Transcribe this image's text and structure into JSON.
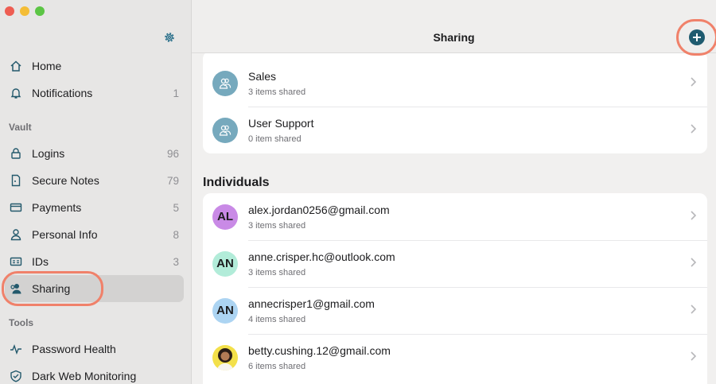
{
  "sidebar": {
    "items": [
      {
        "label": "Home",
        "icon": "home-icon",
        "count": ""
      },
      {
        "label": "Notifications",
        "icon": "bell-icon",
        "count": "1"
      }
    ],
    "vault_label": "Vault",
    "vault_items": [
      {
        "label": "Logins",
        "icon": "lock-icon",
        "count": "96"
      },
      {
        "label": "Secure Notes",
        "icon": "note-icon",
        "count": "79"
      },
      {
        "label": "Payments",
        "icon": "card-icon",
        "count": "5"
      },
      {
        "label": "Personal Info",
        "icon": "person-icon",
        "count": "8"
      },
      {
        "label": "IDs",
        "icon": "id-card-icon",
        "count": "3"
      },
      {
        "label": "Sharing",
        "icon": "sharing-icon",
        "count": ""
      }
    ],
    "tools_label": "Tools",
    "tool_items": [
      {
        "label": "Password Health",
        "icon": "pulse-icon"
      },
      {
        "label": "Dark Web Monitoring",
        "icon": "shield-icon"
      }
    ],
    "selected": "Sharing"
  },
  "header": {
    "title": "Sharing"
  },
  "groups": [
    {
      "name": "Sales",
      "sub": "3 items shared",
      "icon": "group-icon"
    },
    {
      "name": "User Support",
      "sub": "0 item shared",
      "icon": "group-icon"
    }
  ],
  "individuals_label": "Individuals",
  "individuals": [
    {
      "email": "alex.jordan0256@gmail.com",
      "sub": "3 items shared",
      "initials": "AL",
      "color": "#c98ae6"
    },
    {
      "email": "anne.crisper.hc@outlook.com",
      "sub": "3 items shared",
      "initials": "AN",
      "color": "#b2ecd9"
    },
    {
      "email": "annecrisper1@gmail.com",
      "sub": "4 items shared",
      "initials": "AN",
      "color": "#acd4f2"
    },
    {
      "email": "betty.cushing.12@gmail.com",
      "sub": "6 items shared",
      "initials": "",
      "color": "#f3e04a"
    }
  ],
  "colors": {
    "accent": "#1f5b6f",
    "highlight": "#f0816a"
  }
}
